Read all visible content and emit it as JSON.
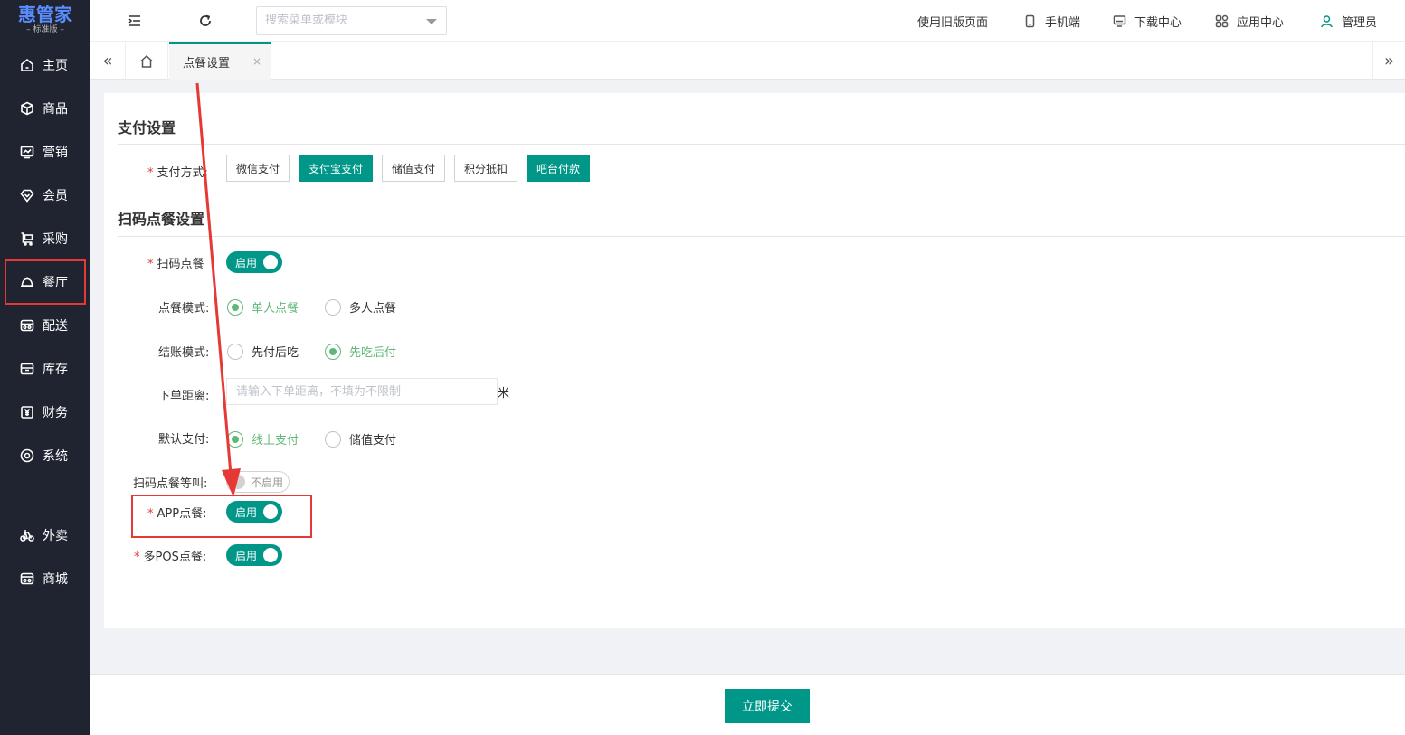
{
  "logo": {
    "title": "惠管家",
    "edition": "标准版"
  },
  "sidebar": {
    "items": [
      {
        "label": "主页",
        "icon": "home-icon"
      },
      {
        "label": "商品",
        "icon": "box-icon"
      },
      {
        "label": "营销",
        "icon": "chart-icon"
      },
      {
        "label": "会员",
        "icon": "diamond-icon"
      },
      {
        "label": "采购",
        "icon": "cart-icon"
      },
      {
        "label": "餐厅",
        "icon": "bell-icon"
      },
      {
        "label": "配送",
        "icon": "delivery-icon"
      },
      {
        "label": "库存",
        "icon": "archive-icon"
      },
      {
        "label": "财务",
        "icon": "yen-icon"
      },
      {
        "label": "系统",
        "icon": "target-icon"
      },
      {
        "label": "外卖",
        "icon": "bike-icon"
      },
      {
        "label": "商城",
        "icon": "store-icon"
      }
    ],
    "active": "餐厅"
  },
  "topbar": {
    "search_placeholder": "搜索菜单或模块",
    "old_page": "使用旧版页面",
    "mobile": "手机端",
    "download": "下载中心",
    "apps": "应用中心",
    "user": "管理员"
  },
  "tabs": {
    "active_label": "点餐设置",
    "close": "×",
    "prev": "«",
    "next": "»"
  },
  "payment_section": {
    "title": "支付设置",
    "method_label": "支付方式:",
    "methods": [
      {
        "label": "微信支付",
        "selected": false
      },
      {
        "label": "支付宝支付",
        "selected": true
      },
      {
        "label": "储值支付",
        "selected": false
      },
      {
        "label": "积分抵扣",
        "selected": false
      },
      {
        "label": "吧台付款",
        "selected": true
      }
    ]
  },
  "scan_section": {
    "title": "扫码点餐设置",
    "scan_order_label": "扫码点餐",
    "scan_order_switch": "启用",
    "order_mode_label": "点餐模式:",
    "order_mode_options": [
      "单人点餐",
      "多人点餐"
    ],
    "order_mode_selected": "单人点餐",
    "checkout_mode_label": "结账模式:",
    "checkout_mode_options": [
      "先付后吃",
      "先吃后付"
    ],
    "checkout_mode_selected": "先吃后付",
    "distance_label": "下单距离:",
    "distance_placeholder": "请输入下单距离，不填为不限制",
    "distance_unit": "米",
    "default_pay_label": "默认支付:",
    "default_pay_options": [
      "线上支付",
      "储值支付"
    ],
    "default_pay_selected": "线上支付",
    "call_label": "扫码点餐等叫:",
    "call_switch": "不启用",
    "app_label": "APP点餐:",
    "app_switch": "启用",
    "pos_label": "多POS点餐:",
    "pos_switch": "启用"
  },
  "footer": {
    "submit": "立即提交"
  },
  "colors": {
    "primary": "#009688",
    "radio": "#5fb878",
    "annotation": "#e53935",
    "sidebar": "#1f2430"
  }
}
